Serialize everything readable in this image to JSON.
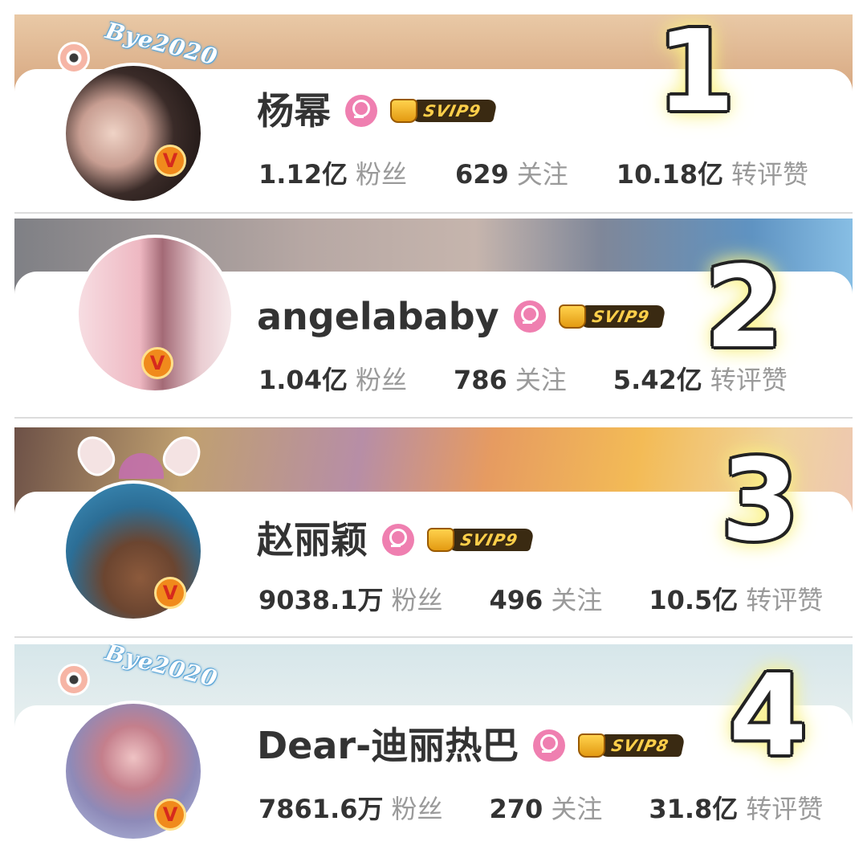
{
  "users": [
    {
      "rank": "1",
      "name": "杨幂",
      "svip": "SVIP9",
      "avatar_deco": "Bye2020",
      "verified_icon": "V",
      "fans": "1.12亿",
      "fans_label": "粉丝",
      "following": "629",
      "following_label": "关注",
      "interactions": "10.18亿",
      "interactions_label": "转评赞"
    },
    {
      "rank": "2",
      "name": "angelababy",
      "svip": "SVIP9",
      "verified_icon": "V",
      "fans": "1.04亿",
      "fans_label": "粉丝",
      "following": "786",
      "following_label": "关注",
      "interactions": "5.42亿",
      "interactions_label": "转评赞"
    },
    {
      "rank": "3",
      "name": "赵丽颖",
      "svip": "SVIP9",
      "verified_icon": "V",
      "fans": "9038.1万",
      "fans_label": "粉丝",
      "following": "496",
      "following_label": "关注",
      "interactions": "10.5亿",
      "interactions_label": "转评赞"
    },
    {
      "rank": "4",
      "name": "Dear-迪丽热巴",
      "svip": "SVIP8",
      "avatar_deco": "Bye2020",
      "verified_icon": "V",
      "fans": "7861.6万",
      "fans_label": "粉丝",
      "following": "270",
      "following_label": "关注",
      "interactions": "31.8亿",
      "interactions_label": "转评赞"
    }
  ],
  "colors": {
    "name_text": "#333333",
    "label_text": "#9a9a9a",
    "gender_female": "#ef7fb0",
    "verified_orange": "#f08a1c",
    "svip_gold": "#ffcf4a"
  }
}
